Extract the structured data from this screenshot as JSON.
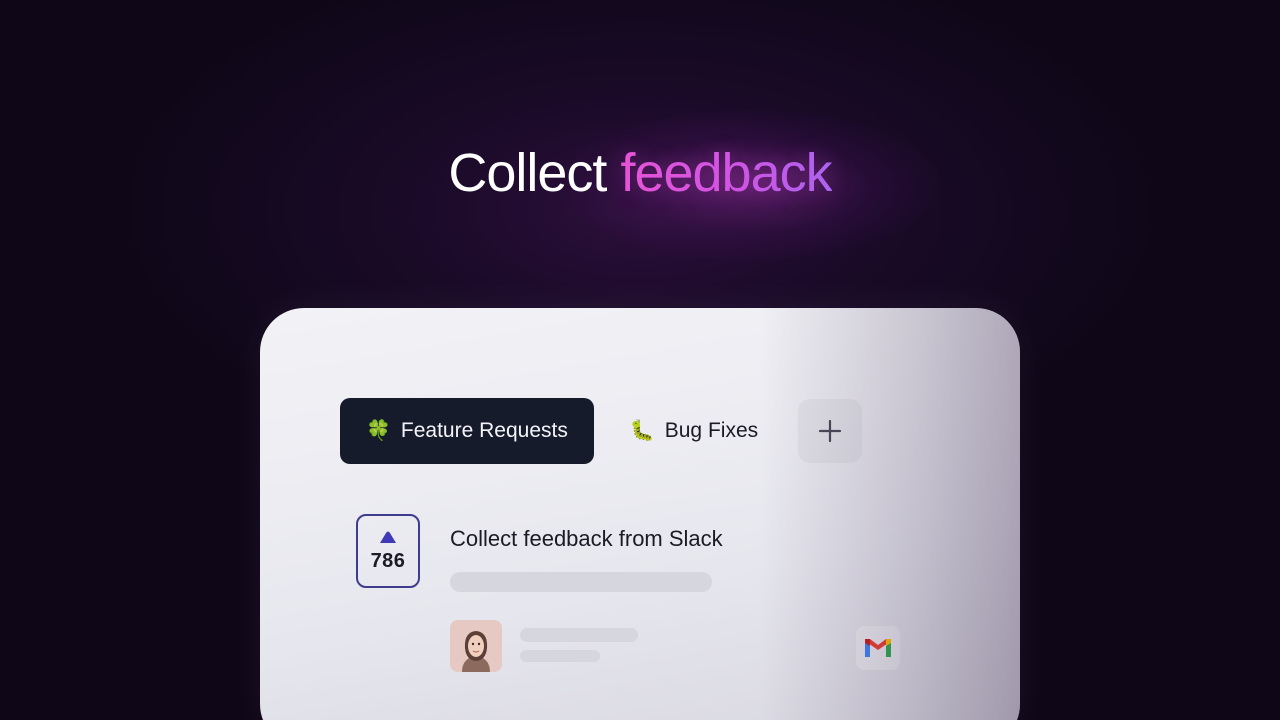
{
  "headline": {
    "plain": "Collect",
    "accent": "feedback"
  },
  "tabs": [
    {
      "label": "Feature Requests",
      "emoji": "🍀",
      "active": true
    },
    {
      "label": "Bug Fixes",
      "emoji": "🐛",
      "active": false
    }
  ],
  "add_tab_icon": "plus-icon",
  "post": {
    "title": "Collect feedback from Slack",
    "votes": "786",
    "upvote_icon": "upvote-icon",
    "source_icon": "gmail-icon"
  },
  "colors": {
    "background": "#140a20",
    "accent_gradient_start": "#e856d6",
    "accent_gradient_end": "#a867f2",
    "active_tab": "#161b2c",
    "vote_border": "#3f3b8f",
    "upvote": "#3f3bb8"
  }
}
